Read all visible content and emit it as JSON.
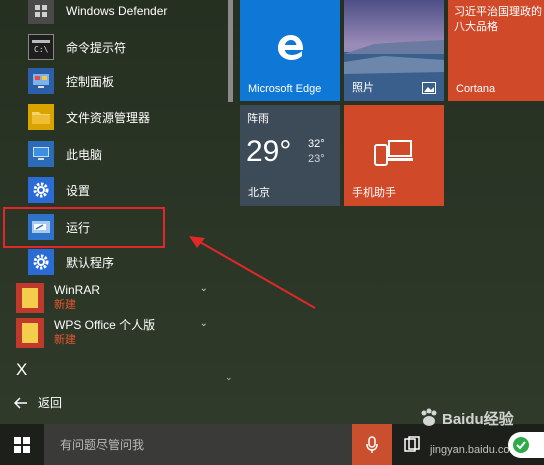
{
  "app_list": {
    "items": [
      {
        "label": "Windows Defender",
        "icon": "shield-icon"
      },
      {
        "label": "命令提示符",
        "icon": "terminal-icon"
      },
      {
        "label": "控制面板",
        "icon": "control-panel-icon"
      },
      {
        "label": "文件资源管理器",
        "icon": "folder-icon"
      },
      {
        "label": "此电脑",
        "icon": "computer-icon"
      },
      {
        "label": "设置",
        "icon": "gear-icon"
      },
      {
        "label": "运行",
        "icon": "run-icon"
      },
      {
        "label": "默认程序",
        "icon": "gear-icon"
      }
    ],
    "groups": [
      {
        "label": "WinRAR",
        "sub": "新建"
      },
      {
        "label": "WPS Office 个人版",
        "sub": "新建"
      }
    ],
    "letter_header": "X",
    "back_label": "返回"
  },
  "tiles": {
    "edge": {
      "label": "Microsoft Edge"
    },
    "photos": {
      "label": "照片"
    },
    "cortana": {
      "label": "Cortana",
      "headline": "习近平治国理政的八大品格"
    },
    "weather": {
      "condition": "阵雨",
      "temp": "29°",
      "high": "32°",
      "low": "23°",
      "city": "北京"
    },
    "phone": {
      "label": "手机助手"
    }
  },
  "taskbar": {
    "search_placeholder": "有问题尽管问我"
  },
  "watermark": {
    "brand": "Baidu经验",
    "url": "jingyan.baidu.com"
  },
  "colors": {
    "edge_blue": "#0f78d6",
    "tile_orange": "#d04929",
    "highlight_red": "#e02828",
    "new_label": "#e8542f"
  }
}
